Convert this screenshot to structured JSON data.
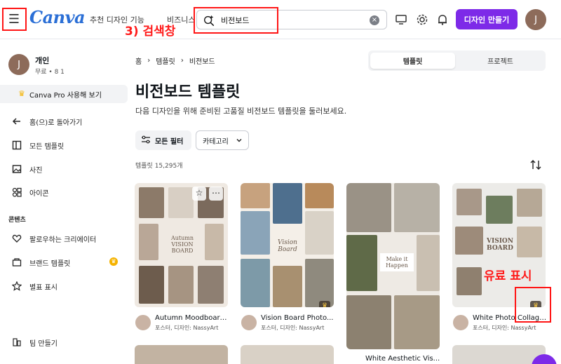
{
  "header": {
    "logo": "Canva",
    "nav": [
      "추천 디자인 기능",
      "비즈니스"
    ],
    "search_value": "비전보드",
    "search_clear": "×",
    "create_button": "디자인 만들기",
    "avatar": "J"
  },
  "annotations": {
    "search_label": "3) 검색창",
    "pro_label": "유료 표시",
    "highlight_color": "#ff1515"
  },
  "sidebar": {
    "profile_initial": "J",
    "profile_name": "개인",
    "profile_sub": "무료 • 8 1",
    "pro_button": "Canva Pro 사용해 보기",
    "items": [
      {
        "label": "홈(으)로 돌아가기",
        "icon": "arrow-left-icon"
      },
      {
        "label": "모든 템플릿",
        "icon": "layout-icon"
      },
      {
        "label": "사진",
        "icon": "image-icon"
      },
      {
        "label": "아이콘",
        "icon": "shapes-icon"
      }
    ],
    "section_title": "콘텐츠",
    "content_items": [
      {
        "label": "팔로우하는 크리에이터",
        "icon": "heart-icon"
      },
      {
        "label": "브랜드 템플릿",
        "icon": "brand-icon"
      },
      {
        "label": "별표 표시",
        "icon": "star-icon"
      }
    ],
    "team_item": "팀 만들기"
  },
  "main": {
    "breadcrumb": [
      "홈",
      "템플릿",
      "비전보드"
    ],
    "tabs": [
      "템플릿",
      "프로젝트"
    ],
    "title": "비전보드 템플릿",
    "description": "다음 디자인을 위해 준비된 고품질 비전보드 템플릿을 둘러보세요.",
    "filter_button": "모든 필터",
    "category_button": "카테고리",
    "count": "템플릿 15,295개"
  },
  "cards": [
    {
      "title": "Autumn Moodboard...",
      "subtitle": "포스터, 디자인: NassyArt",
      "center_text": "Autumn VISION BOARD"
    },
    {
      "title": "Vision Board Photo...",
      "subtitle": "포스터, 디자인: NassyArt",
      "center_text": "Vision Board"
    },
    {
      "title": "",
      "subtitle": "",
      "center_text": "Make it Happen"
    },
    {
      "title": "White Photo Collage...",
      "subtitle": "포스터, 디자인: NassyArt",
      "center_text": "VISION BOARD"
    }
  ],
  "row2": {
    "title3": "White Aesthetic Vis..."
  },
  "colors": {
    "brand_purple": "#7d2ae8",
    "logo_blue": "#2b6fd6",
    "crown": "#f5b300"
  }
}
